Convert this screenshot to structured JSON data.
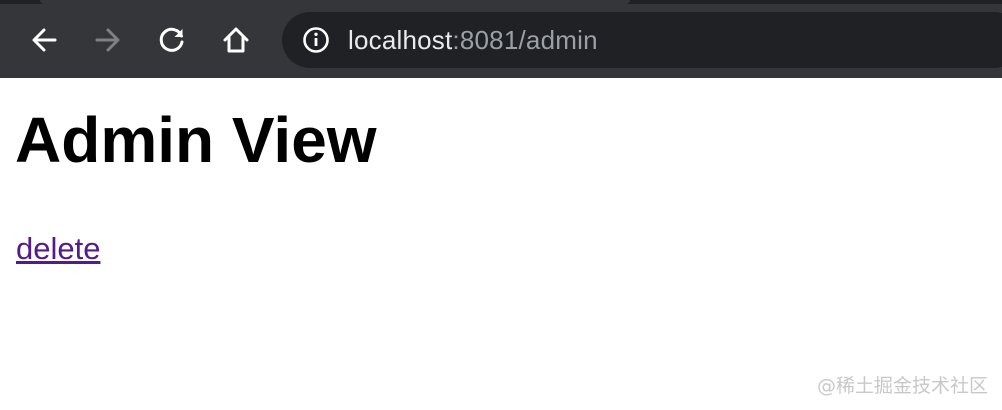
{
  "browser": {
    "nav": {
      "back_icon": "arrow-left-icon",
      "forward_icon": "arrow-right-icon",
      "reload_icon": "reload-icon",
      "home_icon": "home-icon"
    },
    "address_bar": {
      "info_icon": "info-icon",
      "url_host": "localhost",
      "url_rest": ":8081/admin"
    }
  },
  "page": {
    "title": "Admin View",
    "delete_link": "delete"
  },
  "watermark": "@稀土掘金技术社区",
  "colors": {
    "toolbar": "#35363a",
    "omnibox": "#202124",
    "url_host": "#e8eaed",
    "url_rest": "#9aa0a6",
    "visited_link": "#551a8b"
  }
}
